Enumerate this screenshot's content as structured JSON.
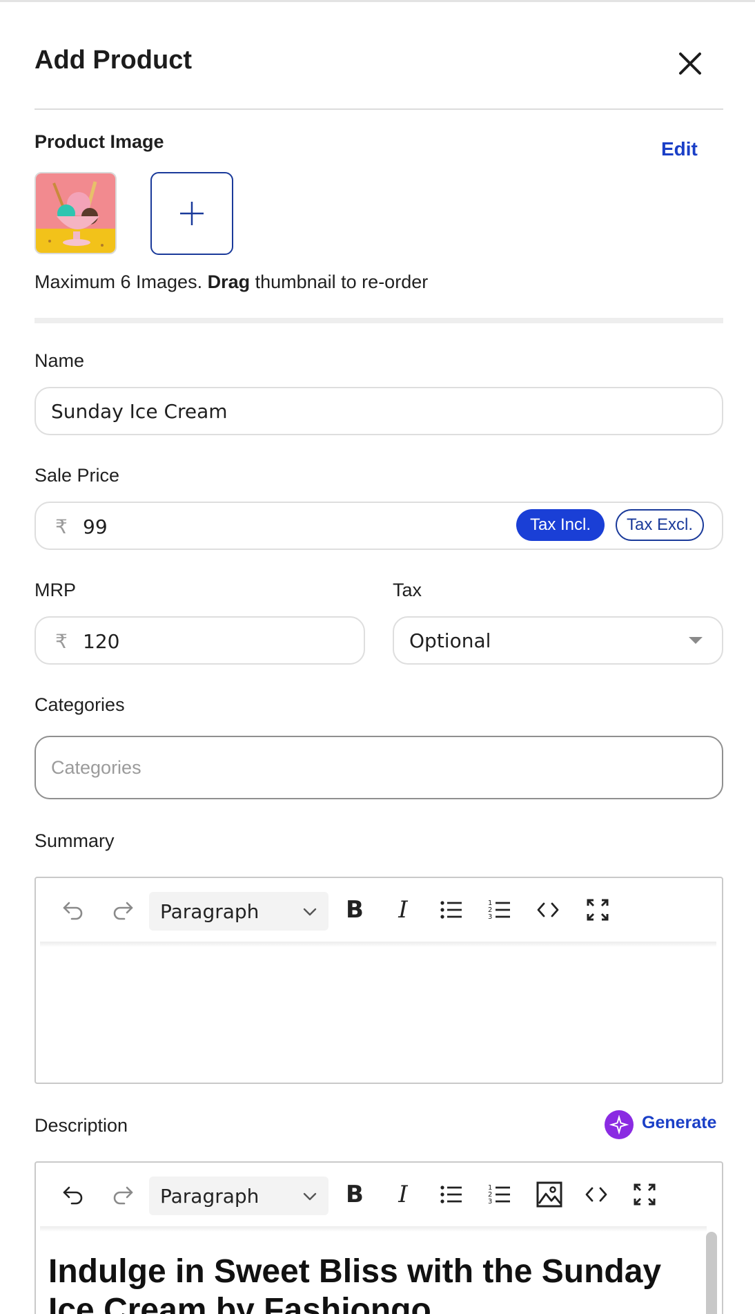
{
  "header": {
    "title": "Add Product",
    "close_icon": "close-icon"
  },
  "product_image": {
    "label": "Product Image",
    "edit_label": "Edit",
    "hint_prefix": "Maximum 6 Images. ",
    "hint_bold": "Drag",
    "hint_suffix": " thumbnail to re-order"
  },
  "name": {
    "label": "Name",
    "value": "Sunday Ice Cream"
  },
  "sale_price": {
    "label": "Sale Price",
    "currency": "₹",
    "value": "99",
    "tax_incl": "Tax Incl.",
    "tax_excl": "Tax Excl.",
    "selected": "Tax Incl."
  },
  "mrp": {
    "label": "MRP",
    "currency": "₹",
    "value": "120"
  },
  "tax": {
    "label": "Tax",
    "value": "Optional"
  },
  "categories": {
    "label": "Categories",
    "placeholder": "Categories"
  },
  "summary": {
    "label": "Summary",
    "block_format": "Paragraph"
  },
  "description": {
    "label": "Description",
    "generate_label": "Generate",
    "block_format": "Paragraph",
    "heading_line1": "Indulge in Sweet Bliss with the Sunday",
    "heading_line2": "Ice Cream by Fashiongo"
  },
  "colors": {
    "accent": "#1a3fd6",
    "link": "#1a3fc7",
    "generate": "#8a2be2"
  }
}
